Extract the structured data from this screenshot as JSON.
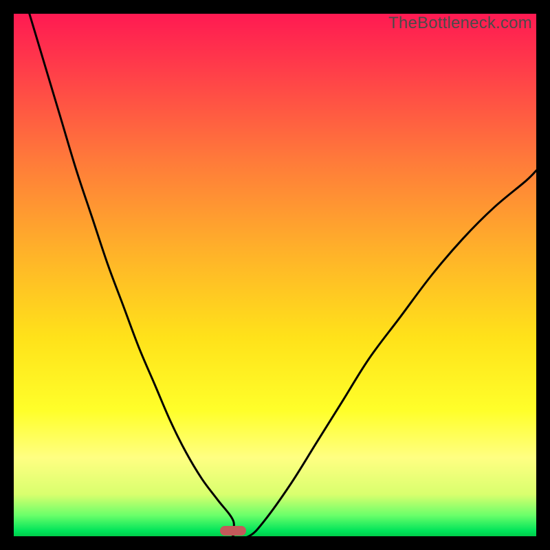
{
  "watermark": "TheBottleneck.com",
  "chart_data": {
    "type": "line",
    "title": "",
    "xlabel": "",
    "ylabel": "",
    "xlim": [
      0,
      100
    ],
    "ylim": [
      0,
      100
    ],
    "legend": false,
    "grid": false,
    "background": "red-yellow-green vertical heat gradient",
    "x": [
      3,
      6,
      9,
      12,
      15,
      18,
      21,
      24,
      27,
      30,
      33,
      36,
      39,
      42,
      42,
      45,
      48,
      53,
      58,
      63,
      68,
      74,
      80,
      86,
      92,
      98,
      100
    ],
    "y": [
      100,
      90,
      80,
      70,
      61,
      52,
      44,
      36,
      29,
      22,
      16,
      11,
      7,
      3,
      0,
      0,
      3,
      10,
      18,
      26,
      34,
      42,
      50,
      57,
      63,
      68,
      70
    ],
    "marker_x": 42,
    "marker_width_pct": 5
  },
  "colors": {
    "curve": "#000000",
    "marker": "#c35a5a",
    "frame": "#000000"
  }
}
